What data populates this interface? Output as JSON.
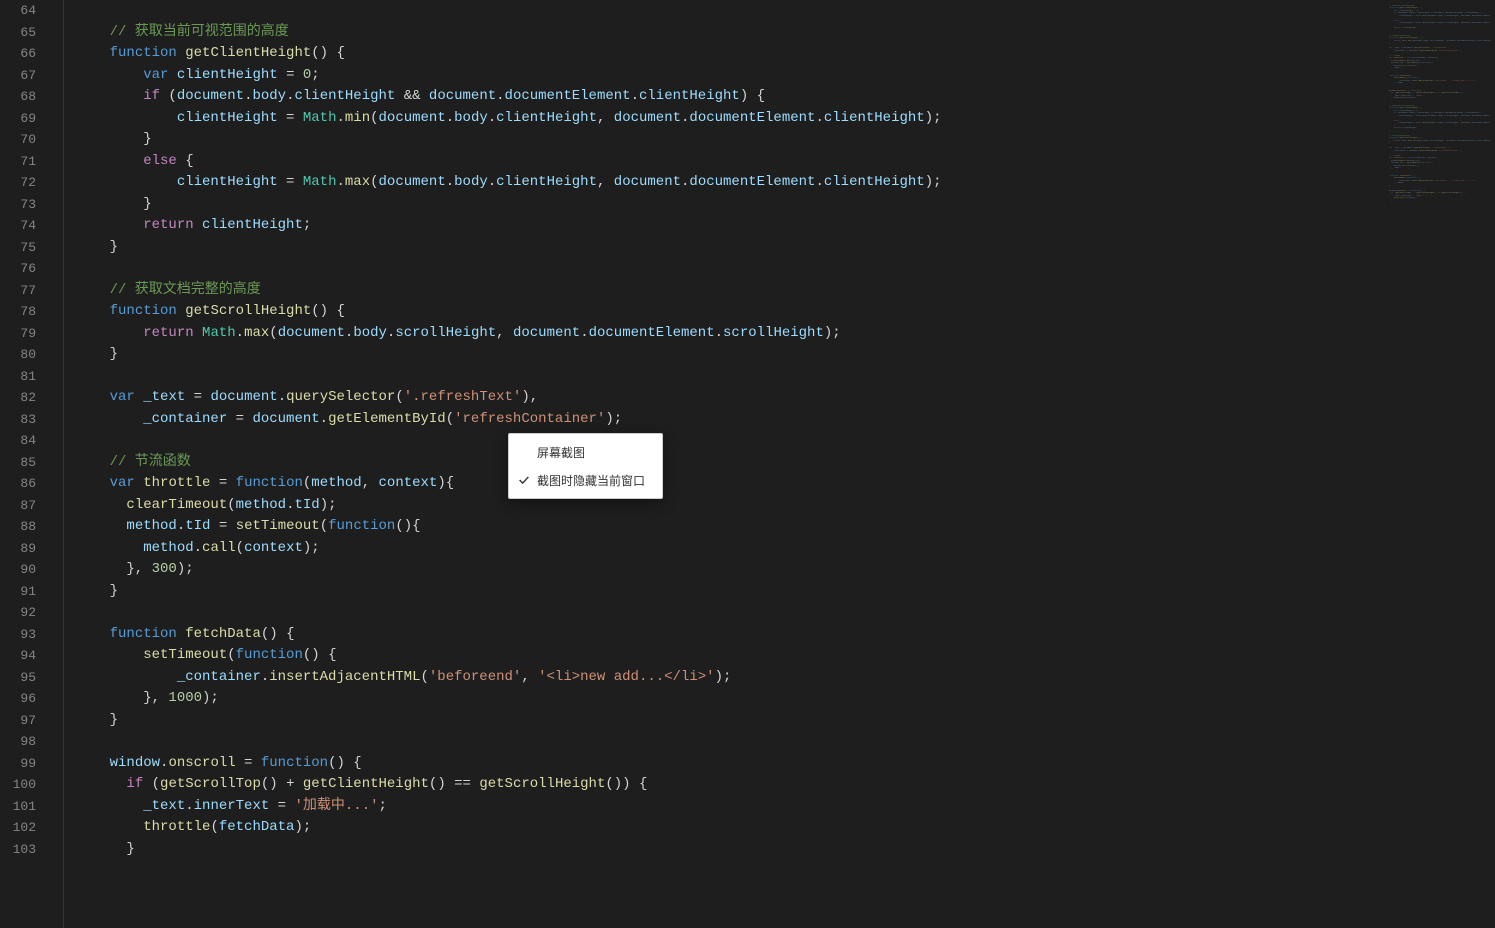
{
  "menu": {
    "item1": "屏幕截图",
    "item2": "截图时隐藏当前窗口"
  },
  "gutter": [
    "64",
    "65",
    "66",
    "67",
    "68",
    "69",
    "70",
    "71",
    "72",
    "73",
    "74",
    "75",
    "76",
    "77",
    "78",
    "79",
    "80",
    "81",
    "82",
    "83",
    "84",
    "85",
    "86",
    "87",
    "88",
    "89",
    "90",
    "91",
    "92",
    "93",
    "94",
    "95",
    "96",
    "97",
    "98",
    "99",
    "100",
    "101",
    "102",
    "103"
  ],
  "code": {
    "lines": [
      {
        "n": "64",
        "t": []
      },
      {
        "n": "65",
        "t": [
          {
            "c": "c-cm",
            "s": "    // 获取当前可视范围的高度"
          }
        ]
      },
      {
        "n": "66",
        "t": [
          {
            "c": "",
            "s": "    "
          },
          {
            "c": "c-dk",
            "s": "function"
          },
          {
            "c": "",
            "s": " "
          },
          {
            "c": "c-fn",
            "s": "getClientHeight"
          },
          {
            "c": "",
            "s": "() {"
          }
        ]
      },
      {
        "n": "67",
        "t": [
          {
            "c": "",
            "s": "        "
          },
          {
            "c": "c-dk",
            "s": "var"
          },
          {
            "c": "",
            "s": " "
          },
          {
            "c": "c-var",
            "s": "clientHeight"
          },
          {
            "c": "",
            "s": " = "
          },
          {
            "c": "c-num",
            "s": "0"
          },
          {
            "c": "",
            "s": ";"
          }
        ]
      },
      {
        "n": "68",
        "t": [
          {
            "c": "",
            "s": "        "
          },
          {
            "c": "c-kw",
            "s": "if"
          },
          {
            "c": "",
            "s": " ("
          },
          {
            "c": "c-var",
            "s": "document"
          },
          {
            "c": "",
            "s": "."
          },
          {
            "c": "c-var",
            "s": "body"
          },
          {
            "c": "",
            "s": "."
          },
          {
            "c": "c-var",
            "s": "clientHeight"
          },
          {
            "c": "",
            "s": " && "
          },
          {
            "c": "c-var",
            "s": "document"
          },
          {
            "c": "",
            "s": "."
          },
          {
            "c": "c-var",
            "s": "documentElement"
          },
          {
            "c": "",
            "s": "."
          },
          {
            "c": "c-var",
            "s": "clientHeight"
          },
          {
            "c": "",
            "s": ") {"
          }
        ]
      },
      {
        "n": "69",
        "t": [
          {
            "c": "",
            "s": "            "
          },
          {
            "c": "c-var",
            "s": "clientHeight"
          },
          {
            "c": "",
            "s": " = "
          },
          {
            "c": "c-cls",
            "s": "Math"
          },
          {
            "c": "",
            "s": "."
          },
          {
            "c": "c-fn",
            "s": "min"
          },
          {
            "c": "",
            "s": "("
          },
          {
            "c": "c-var",
            "s": "document"
          },
          {
            "c": "",
            "s": "."
          },
          {
            "c": "c-var",
            "s": "body"
          },
          {
            "c": "",
            "s": "."
          },
          {
            "c": "c-var",
            "s": "clientHeight"
          },
          {
            "c": "",
            "s": ", "
          },
          {
            "c": "c-var",
            "s": "document"
          },
          {
            "c": "",
            "s": "."
          },
          {
            "c": "c-var",
            "s": "documentElement"
          },
          {
            "c": "",
            "s": "."
          },
          {
            "c": "c-var",
            "s": "clientHeight"
          },
          {
            "c": "",
            "s": ");"
          }
        ]
      },
      {
        "n": "70",
        "t": [
          {
            "c": "",
            "s": "        }"
          }
        ]
      },
      {
        "n": "71",
        "t": [
          {
            "c": "",
            "s": "        "
          },
          {
            "c": "c-kw",
            "s": "else"
          },
          {
            "c": "",
            "s": " {"
          }
        ]
      },
      {
        "n": "72",
        "t": [
          {
            "c": "",
            "s": "            "
          },
          {
            "c": "c-var",
            "s": "clientHeight"
          },
          {
            "c": "",
            "s": " = "
          },
          {
            "c": "c-cls",
            "s": "Math"
          },
          {
            "c": "",
            "s": "."
          },
          {
            "c": "c-fn",
            "s": "max"
          },
          {
            "c": "",
            "s": "("
          },
          {
            "c": "c-var",
            "s": "document"
          },
          {
            "c": "",
            "s": "."
          },
          {
            "c": "c-var",
            "s": "body"
          },
          {
            "c": "",
            "s": "."
          },
          {
            "c": "c-var",
            "s": "clientHeight"
          },
          {
            "c": "",
            "s": ", "
          },
          {
            "c": "c-var",
            "s": "document"
          },
          {
            "c": "",
            "s": "."
          },
          {
            "c": "c-var",
            "s": "documentElement"
          },
          {
            "c": "",
            "s": "."
          },
          {
            "c": "c-var",
            "s": "clientHeight"
          },
          {
            "c": "",
            "s": ");"
          }
        ]
      },
      {
        "n": "73",
        "t": [
          {
            "c": "",
            "s": "        }"
          }
        ]
      },
      {
        "n": "74",
        "t": [
          {
            "c": "",
            "s": "        "
          },
          {
            "c": "c-kw",
            "s": "return"
          },
          {
            "c": "",
            "s": " "
          },
          {
            "c": "c-var",
            "s": "clientHeight"
          },
          {
            "c": "",
            "s": ";"
          }
        ]
      },
      {
        "n": "75",
        "t": [
          {
            "c": "",
            "s": "    }"
          }
        ]
      },
      {
        "n": "76",
        "t": []
      },
      {
        "n": "77",
        "t": [
          {
            "c": "c-cm",
            "s": "    // 获取文档完整的高度"
          }
        ]
      },
      {
        "n": "78",
        "t": [
          {
            "c": "",
            "s": "    "
          },
          {
            "c": "c-dk",
            "s": "function"
          },
          {
            "c": "",
            "s": " "
          },
          {
            "c": "c-fn",
            "s": "getScrollHeight"
          },
          {
            "c": "",
            "s": "() {"
          }
        ]
      },
      {
        "n": "79",
        "t": [
          {
            "c": "",
            "s": "        "
          },
          {
            "c": "c-kw",
            "s": "return"
          },
          {
            "c": "",
            "s": " "
          },
          {
            "c": "c-cls",
            "s": "Math"
          },
          {
            "c": "",
            "s": "."
          },
          {
            "c": "c-fn",
            "s": "max"
          },
          {
            "c": "",
            "s": "("
          },
          {
            "c": "c-var",
            "s": "document"
          },
          {
            "c": "",
            "s": "."
          },
          {
            "c": "c-var",
            "s": "body"
          },
          {
            "c": "",
            "s": "."
          },
          {
            "c": "c-var",
            "s": "scrollHeight"
          },
          {
            "c": "",
            "s": ", "
          },
          {
            "c": "c-var",
            "s": "document"
          },
          {
            "c": "",
            "s": "."
          },
          {
            "c": "c-var",
            "s": "documentElement"
          },
          {
            "c": "",
            "s": "."
          },
          {
            "c": "c-var",
            "s": "scrollHeight"
          },
          {
            "c": "",
            "s": ");"
          }
        ]
      },
      {
        "n": "80",
        "t": [
          {
            "c": "",
            "s": "    }"
          }
        ]
      },
      {
        "n": "81",
        "t": []
      },
      {
        "n": "82",
        "t": [
          {
            "c": "",
            "s": "    "
          },
          {
            "c": "c-dk",
            "s": "var"
          },
          {
            "c": "",
            "s": " "
          },
          {
            "c": "c-var",
            "s": "_text"
          },
          {
            "c": "",
            "s": " = "
          },
          {
            "c": "c-var",
            "s": "document"
          },
          {
            "c": "",
            "s": "."
          },
          {
            "c": "c-fn",
            "s": "querySelector"
          },
          {
            "c": "",
            "s": "("
          },
          {
            "c": "c-str",
            "s": "'.refreshText'"
          },
          {
            "c": "",
            "s": "),"
          }
        ]
      },
      {
        "n": "83",
        "t": [
          {
            "c": "",
            "s": "        "
          },
          {
            "c": "c-var",
            "s": "_container"
          },
          {
            "c": "",
            "s": " = "
          },
          {
            "c": "c-var",
            "s": "document"
          },
          {
            "c": "",
            "s": "."
          },
          {
            "c": "c-fn",
            "s": "getElementById"
          },
          {
            "c": "",
            "s": "("
          },
          {
            "c": "c-str",
            "s": "'refreshContainer'"
          },
          {
            "c": "",
            "s": ");"
          }
        ]
      },
      {
        "n": "84",
        "t": []
      },
      {
        "n": "85",
        "t": [
          {
            "c": "c-cm",
            "s": "    // 节流函数"
          }
        ]
      },
      {
        "n": "86",
        "t": [
          {
            "c": "",
            "s": "    "
          },
          {
            "c": "c-dk",
            "s": "var"
          },
          {
            "c": "",
            "s": " "
          },
          {
            "c": "c-fn",
            "s": "throttle"
          },
          {
            "c": "",
            "s": " = "
          },
          {
            "c": "c-dk",
            "s": "function"
          },
          {
            "c": "",
            "s": "("
          },
          {
            "c": "c-var",
            "s": "method"
          },
          {
            "c": "",
            "s": ", "
          },
          {
            "c": "c-var",
            "s": "context"
          },
          {
            "c": "",
            "s": "){"
          }
        ]
      },
      {
        "n": "87",
        "t": [
          {
            "c": "",
            "s": "      "
          },
          {
            "c": "c-fn",
            "s": "clearTimeout"
          },
          {
            "c": "",
            "s": "("
          },
          {
            "c": "c-var",
            "s": "method"
          },
          {
            "c": "",
            "s": "."
          },
          {
            "c": "c-var",
            "s": "tId"
          },
          {
            "c": "",
            "s": ");"
          }
        ]
      },
      {
        "n": "88",
        "t": [
          {
            "c": "",
            "s": "      "
          },
          {
            "c": "c-var",
            "s": "method"
          },
          {
            "c": "",
            "s": "."
          },
          {
            "c": "c-var",
            "s": "tId"
          },
          {
            "c": "",
            "s": " = "
          },
          {
            "c": "c-fn",
            "s": "setTimeout"
          },
          {
            "c": "",
            "s": "("
          },
          {
            "c": "c-dk",
            "s": "function"
          },
          {
            "c": "",
            "s": "(){"
          }
        ]
      },
      {
        "n": "89",
        "t": [
          {
            "c": "",
            "s": "        "
          },
          {
            "c": "c-var",
            "s": "method"
          },
          {
            "c": "",
            "s": "."
          },
          {
            "c": "c-fn",
            "s": "call"
          },
          {
            "c": "",
            "s": "("
          },
          {
            "c": "c-var",
            "s": "context"
          },
          {
            "c": "",
            "s": ");"
          }
        ]
      },
      {
        "n": "90",
        "t": [
          {
            "c": "",
            "s": "      }, "
          },
          {
            "c": "c-num",
            "s": "300"
          },
          {
            "c": "",
            "s": ");"
          }
        ]
      },
      {
        "n": "91",
        "t": [
          {
            "c": "",
            "s": "    }"
          }
        ]
      },
      {
        "n": "92",
        "t": []
      },
      {
        "n": "93",
        "t": [
          {
            "c": "",
            "s": "    "
          },
          {
            "c": "c-dk",
            "s": "function"
          },
          {
            "c": "",
            "s": " "
          },
          {
            "c": "c-fn",
            "s": "fetchData"
          },
          {
            "c": "",
            "s": "() {"
          }
        ]
      },
      {
        "n": "94",
        "t": [
          {
            "c": "",
            "s": "        "
          },
          {
            "c": "c-fn",
            "s": "setTimeout"
          },
          {
            "c": "",
            "s": "("
          },
          {
            "c": "c-dk",
            "s": "function"
          },
          {
            "c": "",
            "s": "() {"
          }
        ]
      },
      {
        "n": "95",
        "t": [
          {
            "c": "",
            "s": "            "
          },
          {
            "c": "c-var",
            "s": "_container"
          },
          {
            "c": "",
            "s": "."
          },
          {
            "c": "c-fn",
            "s": "insertAdjacentHTML"
          },
          {
            "c": "",
            "s": "("
          },
          {
            "c": "c-str",
            "s": "'beforeend'"
          },
          {
            "c": "",
            "s": ", "
          },
          {
            "c": "c-str",
            "s": "'<li>new add...</li>'"
          },
          {
            "c": "",
            "s": ");"
          }
        ]
      },
      {
        "n": "96",
        "t": [
          {
            "c": "",
            "s": "        }, "
          },
          {
            "c": "c-num",
            "s": "1000"
          },
          {
            "c": "",
            "s": ");"
          }
        ]
      },
      {
        "n": "97",
        "t": [
          {
            "c": "",
            "s": "    }"
          }
        ]
      },
      {
        "n": "98",
        "t": []
      },
      {
        "n": "99",
        "t": [
          {
            "c": "",
            "s": "    "
          },
          {
            "c": "c-var",
            "s": "window"
          },
          {
            "c": "",
            "s": "."
          },
          {
            "c": "c-fn",
            "s": "onscroll"
          },
          {
            "c": "",
            "s": " = "
          },
          {
            "c": "c-dk",
            "s": "function"
          },
          {
            "c": "",
            "s": "() {"
          }
        ]
      },
      {
        "n": "100",
        "t": [
          {
            "c": "",
            "s": "      "
          },
          {
            "c": "c-kw",
            "s": "if"
          },
          {
            "c": "",
            "s": " ("
          },
          {
            "c": "c-fn",
            "s": "getScrollTop"
          },
          {
            "c": "",
            "s": "() + "
          },
          {
            "c": "c-fn",
            "s": "getClientHeight"
          },
          {
            "c": "",
            "s": "() == "
          },
          {
            "c": "c-fn",
            "s": "getScrollHeight"
          },
          {
            "c": "",
            "s": "()) {"
          }
        ]
      },
      {
        "n": "101",
        "t": [
          {
            "c": "",
            "s": "        "
          },
          {
            "c": "c-var",
            "s": "_text"
          },
          {
            "c": "",
            "s": "."
          },
          {
            "c": "c-var",
            "s": "innerText"
          },
          {
            "c": "",
            "s": " = "
          },
          {
            "c": "c-str",
            "s": "'加载中...'"
          },
          {
            "c": "",
            "s": ";"
          }
        ]
      },
      {
        "n": "102",
        "t": [
          {
            "c": "",
            "s": "        "
          },
          {
            "c": "c-fn",
            "s": "throttle"
          },
          {
            "c": "",
            "s": "("
          },
          {
            "c": "c-var",
            "s": "fetchData"
          },
          {
            "c": "",
            "s": ");"
          }
        ]
      },
      {
        "n": "103",
        "t": [
          {
            "c": "",
            "s": "      }"
          }
        ]
      }
    ]
  }
}
